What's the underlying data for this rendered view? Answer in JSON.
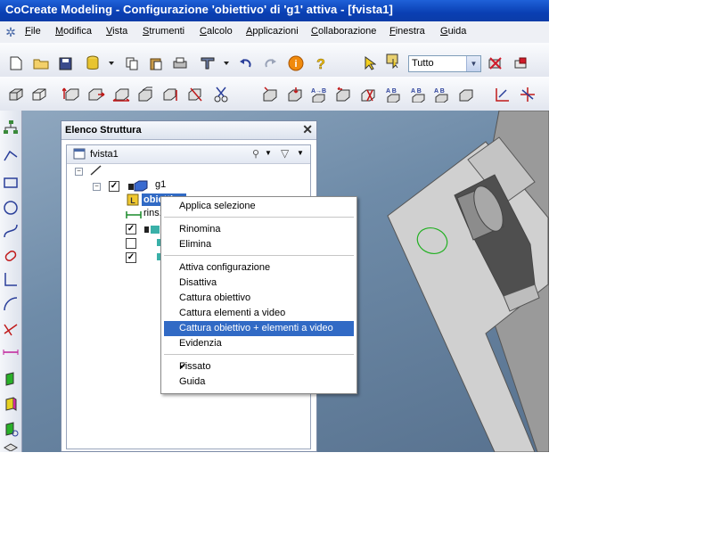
{
  "window": {
    "title": "CoCreate Modeling - Configurazione 'obiettivo' di 'g1' attiva - [fvista1]"
  },
  "menu": [
    {
      "u": "F",
      "rest": "ile"
    },
    {
      "u": "M",
      "rest": "odifica"
    },
    {
      "u": "V",
      "rest": "ista"
    },
    {
      "u": "S",
      "rest": "trumenti"
    },
    {
      "u": "C",
      "rest": "alcolo"
    },
    {
      "u": "A",
      "rest": "pplicazioni"
    },
    {
      "u": "C",
      "rest": "ollaborazione"
    },
    {
      "u": "F",
      "rest": "inestra"
    },
    {
      "u": "G",
      "rest": "uida"
    }
  ],
  "toolbar": {
    "filter_combo_value": "Tutto"
  },
  "panel": {
    "title": "Elenco Struttura",
    "close_glyph": "✕",
    "view_name": "fvista1"
  },
  "tree": {
    "g1": "g1",
    "obiettivo": "obiettivo",
    "rins": "rins1"
  },
  "context_menu": {
    "items": [
      "Applica selezione",
      "Rinomina",
      "Elimina",
      "Attiva configurazione",
      "Disattiva",
      "Cattura obiettivo",
      "Cattura elementi a video",
      "Cattura obiettivo + elementi a video",
      "Evidenzia",
      "Fissato",
      "Guida"
    ],
    "highlighted_index": 7,
    "checked_item": "Fissato"
  },
  "colors": {
    "title_bar": "#0a3fb3",
    "menu_highlight": "#316ac5",
    "model_face": "#d3d3d3",
    "viewport_bg": "#6e8ba8"
  }
}
